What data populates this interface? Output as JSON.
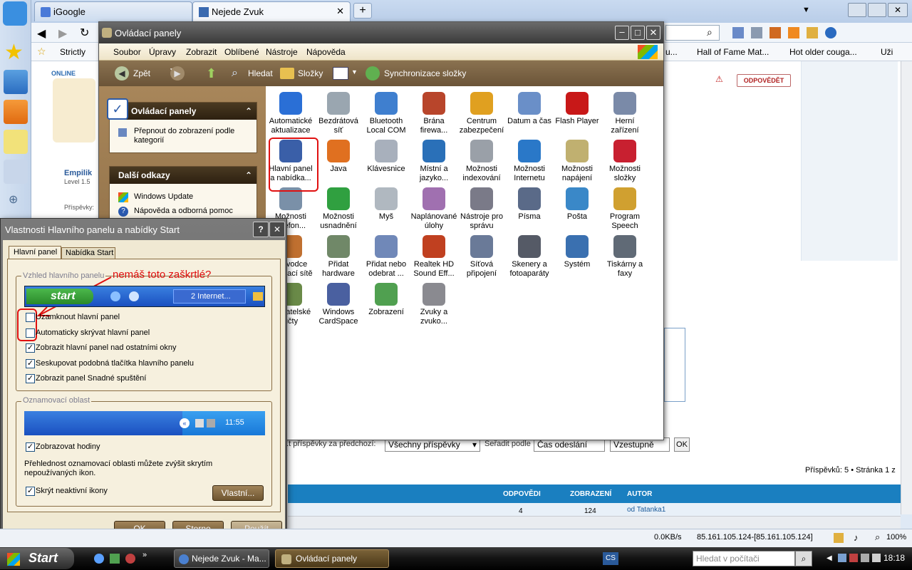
{
  "browser": {
    "tabs": [
      {
        "label": "iGoogle"
      },
      {
        "label": "Nejede Zvuk"
      }
    ],
    "new_tab": "+",
    "bookmarks": [
      "Strictly",
      "u...",
      "Hall of Fame Mat...",
      "Hot older couga...",
      "Uži"
    ],
    "status": {
      "speed": "0.0KB/s",
      "ip": "85.161.105.124-[85.161.105.124]",
      "zoom": "100%"
    }
  },
  "forum": {
    "online": "ONLINE",
    "user": "Empilik",
    "level": "Level 1.5",
    "posts_label": "Příspěvky:",
    "reply": "ODPOVĚDĚT",
    "filter_label": "...t příspěvky za předchozí:",
    "filter_value": "Všechny příspěvky",
    "sort_label": "Seřadit podle",
    "sort_value": "Čas odeslání",
    "order_value": "Vzestupně",
    "ok": "OK",
    "pager": "Příspěvků: 5 • Stránka 1 z",
    "columns": [
      "ODPOVĚDI",
      "ZOBRAZENÍ",
      "AUTOR"
    ],
    "row": {
      "replies": "4",
      "views": "124",
      "author": "od Tatanka1"
    }
  },
  "cp": {
    "title": "Ovládací panely",
    "menu": [
      "Soubor",
      "Úpravy",
      "Zobrazit",
      "Oblíbené",
      "Nástroje",
      "Nápověda"
    ],
    "tool": {
      "back": "Zpět",
      "search": "Hledat",
      "folders": "Složky",
      "sync": "Synchronizace složky"
    },
    "panel1": {
      "title": "Ovládací panely",
      "link": "Přepnout do zobrazení podle kategorií"
    },
    "panel2": {
      "title": "Další odkazy",
      "links": [
        "Windows Update",
        "Nápověda a odborná pomoc"
      ]
    },
    "icons": [
      {
        "label": "Automatické aktualizace",
        "color": "#2a6fd6"
      },
      {
        "label": "Bezdrátová síť",
        "color": "#9aa6b0"
      },
      {
        "label": "Bluetooth Local COM",
        "color": "#3f7fcf"
      },
      {
        "label": "Brána firewa...",
        "color": "#b8452b"
      },
      {
        "label": "Centrum zabezpečení",
        "color": "#e0a020"
      },
      {
        "label": "Datum a čas",
        "color": "#6a8fc8"
      },
      {
        "label": "Flash Player",
        "color": "#c81818"
      },
      {
        "label": "Herní zařízení",
        "color": "#7a8aa8"
      },
      {
        "label": "Hlavní panel a nabídka...",
        "color": "#3a5fa8"
      },
      {
        "label": "Java",
        "color": "#e07020"
      },
      {
        "label": "Klávesnice",
        "color": "#a8b0bc"
      },
      {
        "label": "Místní a jazyko...",
        "color": "#2a70b8"
      },
      {
        "label": "Možnosti indexování",
        "color": "#9aa0a8"
      },
      {
        "label": "Možnosti Internetu",
        "color": "#2a78c8"
      },
      {
        "label": "Možnosti napájení",
        "color": "#c0b070"
      },
      {
        "label": "Možnosti složky",
        "color": "#c82030"
      },
      {
        "label": "Možnosti telefon...",
        "color": "#7a90a8"
      },
      {
        "label": "Možnosti usnadnění",
        "color": "#30a040"
      },
      {
        "label": "Myš",
        "color": "#b0b8c0"
      },
      {
        "label": "Naplánované úlohy",
        "color": "#a070b0"
      },
      {
        "label": "Nástroje pro správu",
        "color": "#7a7a88"
      },
      {
        "label": "Písma",
        "color": "#5a6a88"
      },
      {
        "label": "Pošta",
        "color": "#3a88c8"
      },
      {
        "label": "Program Speech",
        "color": "#d0a030"
      },
      {
        "label": "Průvodce instalací sítě",
        "color": "#c07030"
      },
      {
        "label": "Přidat hardware",
        "color": "#708868"
      },
      {
        "label": "Přidat nebo odebrat ...",
        "color": "#7088b8"
      },
      {
        "label": "Realtek HD Sound Eff...",
        "color": "#c04020"
      },
      {
        "label": "Síťová připojení",
        "color": "#6a7a98"
      },
      {
        "label": "Skenery a fotoaparáty",
        "color": "#555a66"
      },
      {
        "label": "Systém",
        "color": "#3a70b0"
      },
      {
        "label": "Tiskárny a faxy",
        "color": "#606a76"
      },
      {
        "label": "Uživatelské účty",
        "color": "#6a8a48"
      },
      {
        "label": "Windows CardSpace",
        "color": "#4a60a0"
      },
      {
        "label": "Zobrazení",
        "color": "#50a050"
      },
      {
        "label": "Zvuky a zvuko...",
        "color": "#8a8a90"
      }
    ]
  },
  "dialog": {
    "title": "Vlastnosti Hlavního panelu a nabídky Start",
    "help": "?",
    "tabs": [
      "Hlavní panel",
      "Nabídka Start"
    ],
    "group1": "Vzhled hlavního panelu",
    "annotation": "nemáš toto zaškrtlé?",
    "preview": {
      "start": "start",
      "task": "2 Internet...",
      "time": "11:55"
    },
    "checks": [
      {
        "label": "Uzamknout hlavní panel",
        "checked": false
      },
      {
        "label": "Automaticky skrývat hlavní panel",
        "checked": false
      },
      {
        "label": "Zobrazit hlavní panel nad ostatními okny",
        "checked": true
      },
      {
        "label": "Seskupovat podobná tlačítka hlavního panelu",
        "checked": true
      },
      {
        "label": "Zobrazit panel Snadné spuštění",
        "checked": true
      }
    ],
    "group2": "Oznamovací oblast",
    "show_clock": "Zobrazovat hodiny",
    "info": "Přehlednost oznamovací oblasti můžete zvýšit skrytím nepoužívaných ikon.",
    "hide_icons": "Skrýt neaktivní ikony",
    "custom": "Vlastní...",
    "ok": "OK",
    "cancel": "Storno",
    "apply": "Použít"
  },
  "taskbar": {
    "start": "Start",
    "items": [
      {
        "label": "Nejede Zvuk - Ma..."
      },
      {
        "label": "Ovládací panely"
      }
    ],
    "lang": "CS",
    "search_placeholder": "Hledat v počítači",
    "clock": "18:18"
  }
}
